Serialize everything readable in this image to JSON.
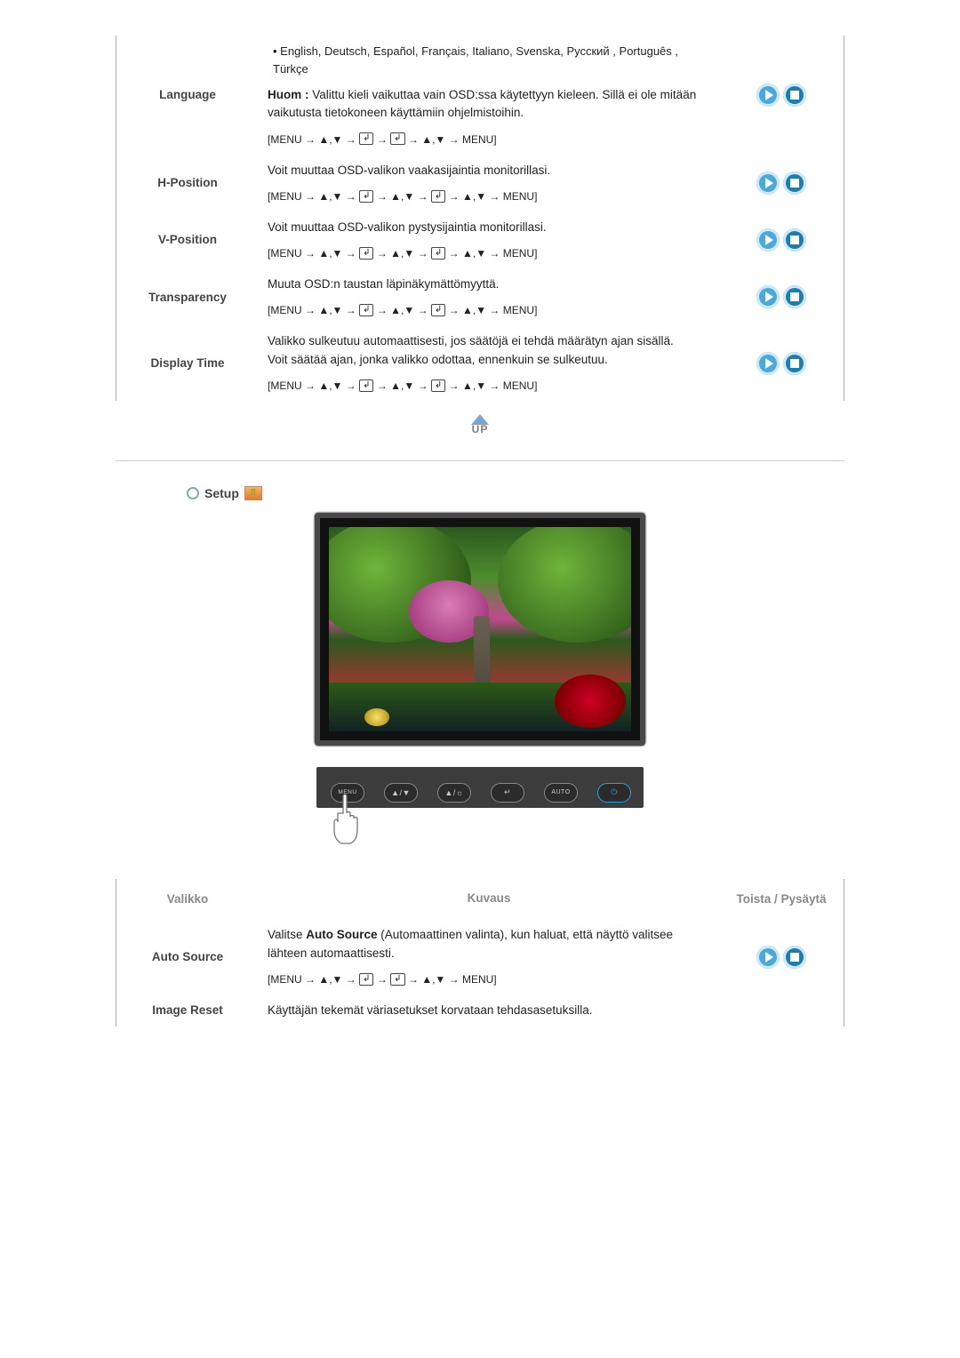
{
  "table1": {
    "rows": [
      {
        "name": "Language",
        "lang_list": "English, Deutsch, Español, Français,  Italiano, Svenska, Русский , Português , Türkçe",
        "desc_prefix": "Huom :",
        "desc": " Valittu kieli vaikuttaa vain OSD:ssa käytettyyn kieleen. Sillä ei ole mitään vaikutusta tietokoneen käyttämiin ohjelmistoihin.",
        "seq": "[MENU → ▲,▼ → ↵ → ↵ → ▲,▼ → MENU]"
      },
      {
        "name": "H-Position",
        "desc": "Voit muuttaa OSD-valikon vaakasijaintia monitorillasi.",
        "seq": "[MENU → ▲,▼ → ↵ → ▲,▼ → ↵ → ▲,▼ → MENU]"
      },
      {
        "name": "V-Position",
        "desc": "Voit muuttaa OSD-valikon pystysijaintia monitorillasi.",
        "seq": "[MENU → ▲,▼ → ↵ → ▲,▼ → ↵ → ▲,▼ → MENU]"
      },
      {
        "name": "Transparency",
        "desc": "Muuta OSD:n taustan läpinäkymättömyyttä.",
        "seq": "[MENU → ▲,▼ → ↵ → ▲,▼ → ↵ → ▲,▼ → MENU]"
      },
      {
        "name": "Display Time",
        "desc": "Valikko sulkeutuu automaattisesti, jos säätöjä ei tehdä määrätyn ajan sisällä.\nVoit säätää ajan, jonka valikko odottaa, ennenkuin se sulkeutuu.",
        "seq": "[MENU → ▲,▼ → ↵ → ▲,▼ → ↵ → ▲,▼ → MENU]"
      }
    ]
  },
  "up_label": "UP",
  "section_setup": "Setup",
  "buttons": {
    "menu": "MENU",
    "updown": "▲/▼",
    "bright": "▲/☼",
    "enter": "↵",
    "auto": "AUTO",
    "power": "⏻"
  },
  "table2": {
    "headers": {
      "menu": "Valikko",
      "desc": "Kuvaus",
      "actions": "Toista / Pysäytä"
    },
    "rows": [
      {
        "name": "Auto Source",
        "desc_pre": "Valitse ",
        "desc_bold": "Auto Source",
        "desc_post": " (Automaattinen valinta), kun haluat, että näyttö valitsee lähteen automaattisesti.",
        "seq": "[MENU → ▲,▼ → ↵ → ↵ → ▲,▼ → MENU]"
      },
      {
        "name": "Image Reset",
        "desc": "Käyttäjän tekemät väriasetukset korvataan tehdasasetuksilla."
      }
    ]
  }
}
